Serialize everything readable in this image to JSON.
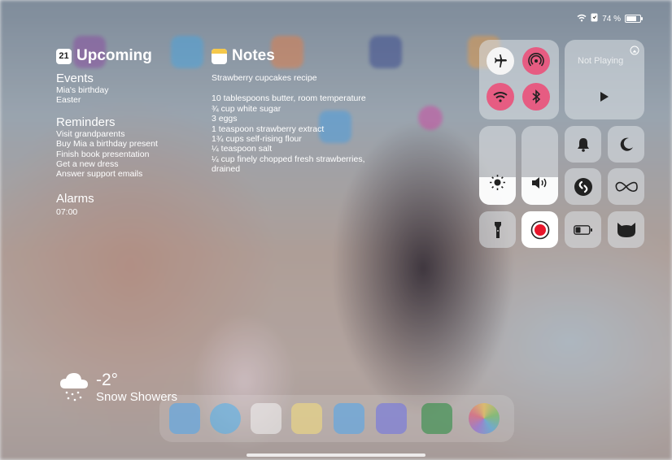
{
  "status": {
    "battery_percent": "74 %",
    "battery_level": 0.74
  },
  "upcoming": {
    "date": "21",
    "title": "Upcoming",
    "events_heading": "Events",
    "events": [
      "Mia's birthday",
      "Easter"
    ],
    "reminders_heading": "Reminders",
    "reminders": [
      "Visit grandparents",
      "Buy Mia a birthday present",
      "Finish book presentation",
      "Get a new dress",
      "Answer support emails"
    ],
    "alarms_heading": "Alarms",
    "alarms": [
      "07:00"
    ]
  },
  "notes": {
    "title": "Notes",
    "note_title": "Strawberry cupcakes recipe",
    "lines": [
      "10 tablespoons butter, room temperature",
      "¾ cup white sugar",
      "3 eggs",
      "1 teaspoon strawberry extract",
      "1¾ cups self-rising flour",
      "¼ teaspoon salt",
      "¼ cup finely chopped fresh strawberries, drained"
    ]
  },
  "weather": {
    "temp": "-2°",
    "condition": "Snow Showers"
  },
  "control_center": {
    "now_playing": "Not Playing",
    "brightness_level": 0.35,
    "volume_level": 0.35,
    "accent_on": "#e65c82",
    "record_color": "#e8162b"
  }
}
